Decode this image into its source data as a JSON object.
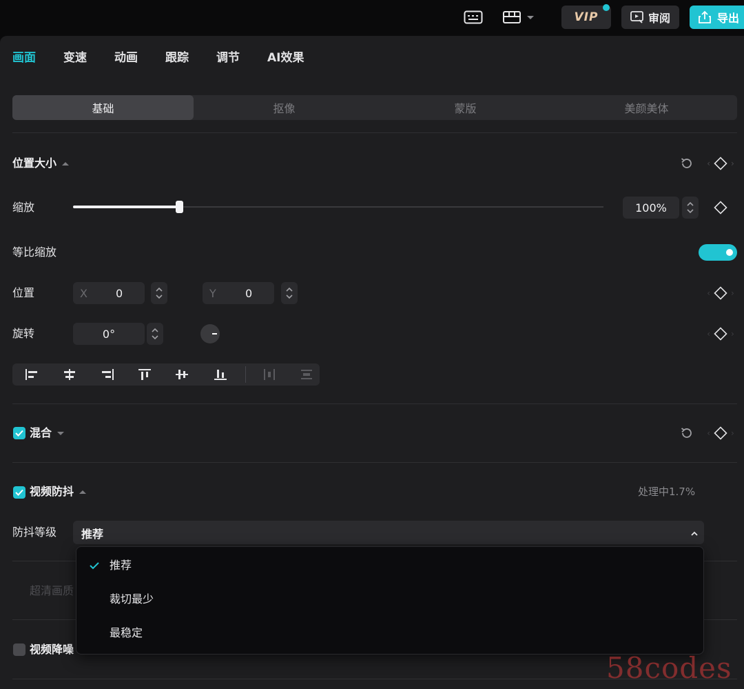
{
  "topbar": {
    "keyboard_icon": "keyboard-icon",
    "layout_icon": "layout-icon",
    "vip_label": "VIP",
    "review_label": "审阅",
    "export_label": "导出"
  },
  "tabs": [
    {
      "label": "画面",
      "active": true
    },
    {
      "label": "变速"
    },
    {
      "label": "动画"
    },
    {
      "label": "跟踪"
    },
    {
      "label": "调节"
    },
    {
      "label": "AI效果"
    }
  ],
  "subtabs": [
    {
      "label": "基础",
      "active": true
    },
    {
      "label": "抠像"
    },
    {
      "label": "蒙版"
    },
    {
      "label": "美颜美体"
    }
  ],
  "position_size": {
    "title": "位置大小",
    "scale_label": "缩放",
    "scale_value": "100%",
    "scale_fraction": 0.2,
    "uniform_scale_label": "等比缩放",
    "uniform_scale_on": true,
    "position_label": "位置",
    "x_label": "X",
    "x_value": "0",
    "y_label": "Y",
    "y_value": "0",
    "rotation_label": "旋转",
    "rotation_value": "0°"
  },
  "blend": {
    "title": "混合",
    "checked": true
  },
  "stabilize": {
    "title": "视频防抖",
    "checked": true,
    "status": "处理中1.7%",
    "level_label": "防抖等级",
    "selected": "推荐",
    "options": [
      "推荐",
      "裁切最少",
      "最稳定"
    ]
  },
  "hidden_rows": {
    "super_res_label": "超清画质",
    "denoise_label": "视频降噪"
  },
  "watermark": "58codes",
  "colors": {
    "accent": "#21c4d2",
    "panel_bg": "#1e1e20",
    "control_bg": "#2b2b2e"
  }
}
